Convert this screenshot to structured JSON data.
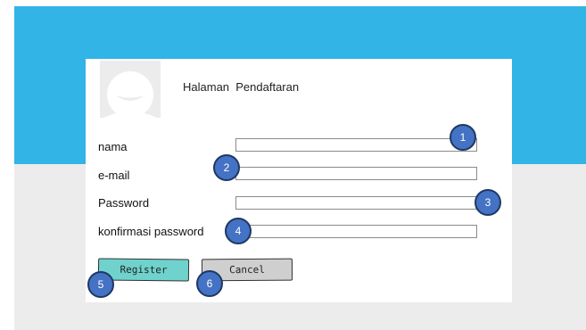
{
  "header": {
    "title": "Halaman  Pendaftaran",
    "avatar_icon": "user-avatar-icon"
  },
  "form": {
    "fields": [
      {
        "label": "nama",
        "value": "",
        "placeholder": ""
      },
      {
        "label": "e-mail",
        "value": "",
        "placeholder": ""
      },
      {
        "label": "Password",
        "value": "",
        "placeholder": ""
      },
      {
        "label": "konfirmasi password",
        "value": "",
        "placeholder": ""
      }
    ]
  },
  "buttons": {
    "register_label": "Register",
    "cancel_label": "Cancel"
  },
  "markers": [
    "1",
    "2",
    "3",
    "4",
    "5",
    "6"
  ],
  "colors": {
    "banner": "#32b4e6",
    "background": "#ececec",
    "marker_fill": "#4472c4",
    "marker_border": "#1f3864",
    "register_button": "#6fd2cc",
    "cancel_button": "#cfcfcf"
  }
}
